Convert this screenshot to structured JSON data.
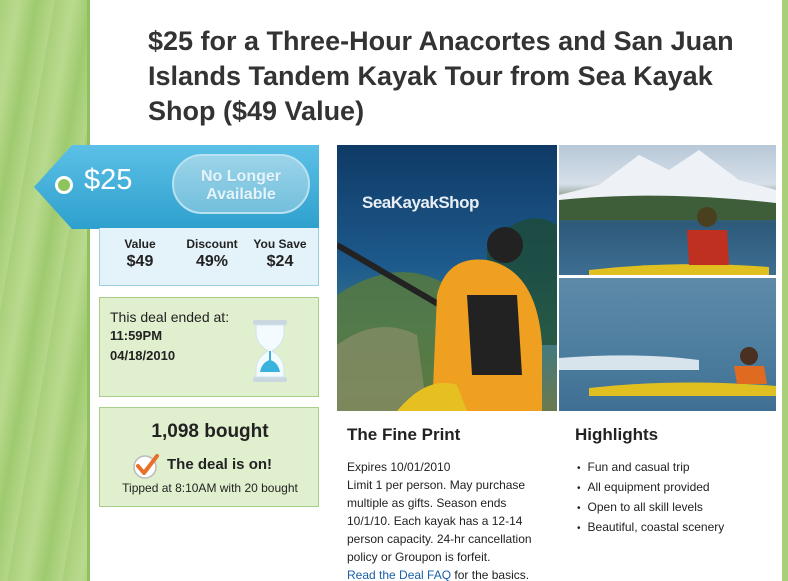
{
  "deal": {
    "title": "$25 for a Three-Hour Anacortes and San Juan Islands Tandem Kayak Tour from Sea Kayak Shop ($49 Value)",
    "price": "$25",
    "status_button": "No Longer Available",
    "stats": [
      {
        "label": "Value",
        "value": "$49"
      },
      {
        "label": "Discount",
        "value": "49%"
      },
      {
        "label": "You Save",
        "value": "$24"
      }
    ]
  },
  "ended": {
    "label": "This deal ended at:",
    "time": "11:59PM",
    "date": "04/18/2010"
  },
  "bought": {
    "count": "1,098  bought",
    "status": "The deal is on!",
    "tipped": "Tipped at 8:10AM with 20 bought"
  },
  "photos": {
    "logo_text": "SeaKayakShop"
  },
  "fine_print": {
    "title": "The Fine Print",
    "expires": "Expires 10/01/2010",
    "body": "Limit 1 per person. May purchase multiple as gifts. Season ends 10/1/10. Each kayak has a 12-14 person capacity. 24-hr cancellation policy or Groupon is forfeit.",
    "faq_link": "Read the Deal FAQ",
    "faq_suffix": " for the basics."
  },
  "highlights": {
    "title": "Highlights",
    "items": [
      "Fun and casual trip",
      "All equipment provided",
      "Open to all skill levels",
      "Beautiful, coastal scenery"
    ]
  },
  "colors": {
    "tag_blue": "#3aaad4",
    "green_panel": "#e0f0cf",
    "link_blue": "#1a5fa8",
    "check_orange": "#e8702a"
  }
}
